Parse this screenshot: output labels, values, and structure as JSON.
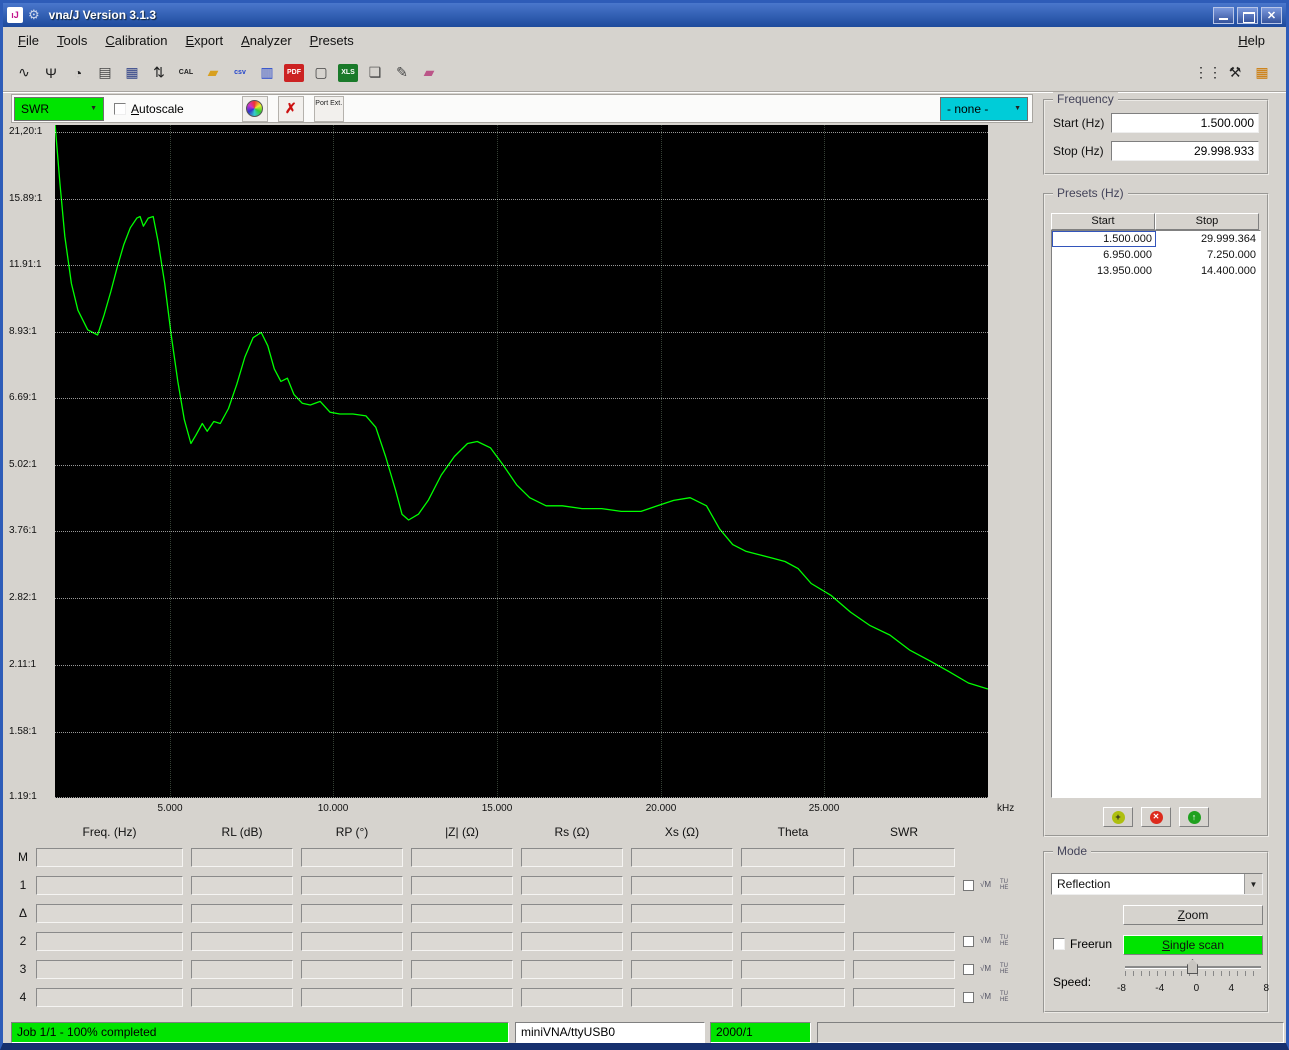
{
  "window": {
    "title": "vna/J Version 3.1.3"
  },
  "menu": {
    "items": [
      "File",
      "Tools",
      "Calibration",
      "Export",
      "Analyzer",
      "Presets"
    ],
    "help": "Help"
  },
  "toolbar": {
    "left_icons": [
      {
        "name": "generator-icon",
        "glyph": "∿",
        "color": "#222222"
      },
      {
        "name": "antenna-icon",
        "glyph": "Ψ",
        "color": "#222222"
      },
      {
        "name": "schedule-icon",
        "glyph": "◔",
        "color": "#222222"
      },
      {
        "name": "print-icon",
        "glyph": "▤",
        "color": "#444444"
      },
      {
        "name": "marker-data-icon",
        "glyph": "▦",
        "color": "#334488"
      },
      {
        "name": "frequency-pairs-icon",
        "glyph": "⇅",
        "color": "#222222"
      },
      {
        "name": "cal-icon",
        "glyph": "CAL",
        "color": "#222222",
        "txt": true
      },
      {
        "name": "load-cal-icon",
        "glyph": "▰",
        "color": "#d8a020"
      },
      {
        "name": "export-csv-icon",
        "glyph": "csv",
        "color": "#2244cc",
        "txt": true
      },
      {
        "name": "report-icon",
        "glyph": "▥",
        "color": "#2244cc"
      },
      {
        "name": "export-pdf-icon",
        "glyph": "PDF",
        "color": "#ffffff",
        "bg": "#cc2222",
        "txt": true
      },
      {
        "name": "snapshot-icon",
        "glyph": "▢",
        "color": "#444444"
      },
      {
        "name": "export-xls-icon",
        "glyph": "XLS",
        "color": "#ffffff",
        "bg": "#1a7a2a",
        "txt": true
      },
      {
        "name": "clipboard-icon",
        "glyph": "❏",
        "color": "#444444"
      },
      {
        "name": "analysis-icon",
        "glyph": "✎",
        "color": "#444444"
      },
      {
        "name": "eraser-icon",
        "glyph": "▰",
        "color": "#bb5588"
      }
    ],
    "right_icons": [
      {
        "name": "sliders-icon",
        "glyph": "⋮⋮",
        "color": "#222222"
      },
      {
        "name": "wrench-icon",
        "glyph": "⚒",
        "color": "#222222"
      },
      {
        "name": "color-scheme-icon",
        "glyph": "▦",
        "color": "#cc7700"
      }
    ]
  },
  "chart_controls": {
    "scale_select": "SWR",
    "scale_color": "#00e400",
    "autoscale_label": "Autoscale",
    "port_ext_label": "Port Ext.",
    "marker_select": "- none -",
    "marker_select_color": "#00ccd8"
  },
  "chart_data": {
    "type": "line",
    "title": "SWR vs frequency sweep",
    "x_unit_label": "kHz",
    "x_range_mhz": [
      1.5,
      30.0
    ],
    "x_ticks": [
      {
        "mhz": 5,
        "label": "5.000"
      },
      {
        "mhz": 10,
        "label": "10.000"
      },
      {
        "mhz": 15,
        "label": "15.000"
      },
      {
        "mhz": 20,
        "label": "20.000"
      },
      {
        "mhz": 25,
        "label": "25.000"
      }
    ],
    "y_scale": "log",
    "y_ticks": [
      {
        "v": 21.2,
        "label": "21,20:1"
      },
      {
        "v": 15.89,
        "label": "15.89:1"
      },
      {
        "v": 11.91,
        "label": "11.91:1"
      },
      {
        "v": 8.93,
        "label": "8.93:1"
      },
      {
        "v": 6.69,
        "label": "6.69:1"
      },
      {
        "v": 5.02,
        "label": "5.02:1"
      },
      {
        "v": 3.76,
        "label": "3.76:1"
      },
      {
        "v": 2.82,
        "label": "2.82:1"
      },
      {
        "v": 2.11,
        "label": "2.11:1"
      },
      {
        "v": 1.58,
        "label": "1.58:1"
      },
      {
        "v": 1.19,
        "label": "1.19:1"
      }
    ],
    "grid": "dotted",
    "legend": false,
    "series": [
      {
        "name": "SWR",
        "color": "#00ff00",
        "points": [
          [
            1.5,
            22.0
          ],
          [
            1.65,
            17.0
          ],
          [
            1.8,
            13.5
          ],
          [
            2.0,
            11.0
          ],
          [
            2.2,
            9.8
          ],
          [
            2.5,
            9.0
          ],
          [
            2.8,
            8.8
          ],
          [
            3.0,
            9.6
          ],
          [
            3.2,
            10.6
          ],
          [
            3.4,
            11.8
          ],
          [
            3.6,
            13.0
          ],
          [
            3.8,
            14.0
          ],
          [
            4.0,
            14.6
          ],
          [
            4.1,
            14.7
          ],
          [
            4.2,
            14.1
          ],
          [
            4.35,
            14.6
          ],
          [
            4.5,
            14.7
          ],
          [
            4.65,
            13.2
          ],
          [
            4.85,
            11.0
          ],
          [
            5.05,
            8.8
          ],
          [
            5.25,
            7.2
          ],
          [
            5.45,
            6.1
          ],
          [
            5.65,
            5.5
          ],
          [
            5.8,
            5.7
          ],
          [
            6.0,
            6.0
          ],
          [
            6.15,
            5.8
          ],
          [
            6.35,
            6.05
          ],
          [
            6.55,
            6.0
          ],
          [
            6.8,
            6.4
          ],
          [
            7.05,
            7.1
          ],
          [
            7.3,
            8.0
          ],
          [
            7.55,
            8.7
          ],
          [
            7.8,
            8.9
          ],
          [
            8.0,
            8.4
          ],
          [
            8.2,
            7.6
          ],
          [
            8.4,
            7.2
          ],
          [
            8.6,
            7.3
          ],
          [
            8.8,
            6.8
          ],
          [
            9.05,
            6.55
          ],
          [
            9.3,
            6.5
          ],
          [
            9.6,
            6.6
          ],
          [
            9.9,
            6.3
          ],
          [
            10.2,
            6.25
          ],
          [
            10.6,
            6.25
          ],
          [
            11.0,
            6.2
          ],
          [
            11.3,
            5.9
          ],
          [
            11.6,
            5.2
          ],
          [
            11.9,
            4.5
          ],
          [
            12.1,
            4.05
          ],
          [
            12.3,
            3.95
          ],
          [
            12.6,
            4.05
          ],
          [
            12.9,
            4.3
          ],
          [
            13.3,
            4.8
          ],
          [
            13.7,
            5.2
          ],
          [
            14.1,
            5.5
          ],
          [
            14.4,
            5.55
          ],
          [
            14.8,
            5.4
          ],
          [
            15.2,
            5.0
          ],
          [
            15.6,
            4.6
          ],
          [
            16.0,
            4.35
          ],
          [
            16.5,
            4.2
          ],
          [
            17.0,
            4.2
          ],
          [
            17.6,
            4.15
          ],
          [
            18.2,
            4.15
          ],
          [
            18.8,
            4.1
          ],
          [
            19.4,
            4.1
          ],
          [
            19.9,
            4.2
          ],
          [
            20.4,
            4.3
          ],
          [
            20.9,
            4.35
          ],
          [
            21.4,
            4.2
          ],
          [
            21.8,
            3.8
          ],
          [
            22.2,
            3.55
          ],
          [
            22.6,
            3.45
          ],
          [
            23.0,
            3.4
          ],
          [
            23.4,
            3.35
          ],
          [
            23.8,
            3.3
          ],
          [
            24.2,
            3.2
          ],
          [
            24.6,
            3.0
          ],
          [
            25.2,
            2.85
          ],
          [
            25.8,
            2.65
          ],
          [
            26.4,
            2.5
          ],
          [
            27.0,
            2.4
          ],
          [
            27.6,
            2.25
          ],
          [
            28.2,
            2.15
          ],
          [
            28.8,
            2.05
          ],
          [
            29.4,
            1.95
          ],
          [
            30.0,
            1.9
          ]
        ]
      }
    ]
  },
  "frequency_panel": {
    "title": "Frequency",
    "start_label": "Start (Hz)",
    "start_value": "1.500.000",
    "stop_label": "Stop (Hz)",
    "stop_value": "29.998.933"
  },
  "presets_panel": {
    "title": "Presets (Hz)",
    "columns": [
      "Start",
      "Stop"
    ],
    "rows": [
      [
        "1.500.000",
        "29.999.364"
      ],
      [
        "6.950.000",
        "7.250.000"
      ],
      [
        "13.950.000",
        "14.400.000"
      ]
    ]
  },
  "mode_panel": {
    "title": "Mode",
    "mode_value": "Reflection",
    "zoom_label": "Zoom",
    "freerun_label": "Freerun",
    "single_scan_label": "Single scan",
    "single_scan_color": "#00e400",
    "speed_label": "Speed:",
    "speed_ticks": [
      "-8",
      "-4",
      "0",
      "4",
      "8"
    ]
  },
  "markers_table": {
    "headers": [
      "Freq. (Hz)",
      "RL (dB)",
      "RP (°)",
      "|Z| (Ω)",
      "Rs (Ω)",
      "Xs (Ω)",
      "Theta",
      "SWR"
    ],
    "rows": [
      {
        "label": "M",
        "cells": 8,
        "extras": false
      },
      {
        "label": "1",
        "cells": 8,
        "extras": true
      },
      {
        "label": "Δ",
        "cells": 7,
        "extras": false
      },
      {
        "label": "2",
        "cells": 8,
        "extras": true
      },
      {
        "label": "3",
        "cells": 8,
        "extras": true
      },
      {
        "label": "4",
        "cells": 8,
        "extras": true
      }
    ],
    "extras_icons": {
      "sqrt_glyph": "√M",
      "tu_glyph": "TU",
      "he_glyph": "HE"
    }
  },
  "status_bar": {
    "progress": "Job 1/1 - 100% completed",
    "device": "miniVNA/ttyUSB0",
    "samples": "2000/1",
    "ok_color": "#00e400"
  }
}
